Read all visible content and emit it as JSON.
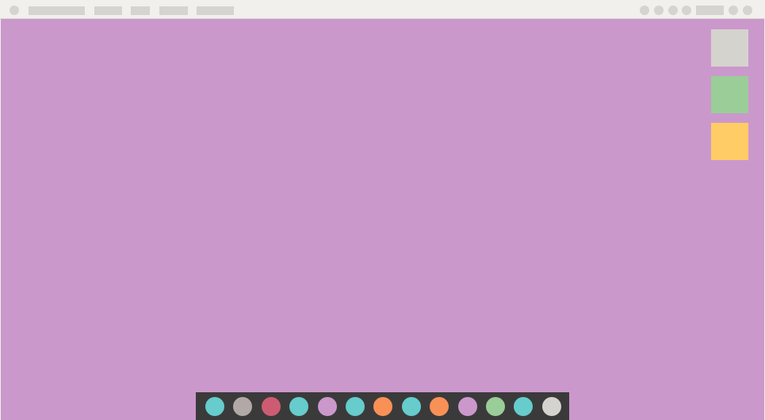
{
  "menubar": {
    "items": [
      {
        "name": "app-menu-icon"
      },
      {
        "name": "app-name-placeholder"
      },
      {
        "name": "menu-item-1"
      },
      {
        "name": "menu-item-2"
      },
      {
        "name": "menu-item-3"
      },
      {
        "name": "menu-item-4"
      }
    ],
    "status_icons": [
      "status-icon-1",
      "status-icon-2",
      "status-icon-3",
      "status-icon-4",
      "clock-placeholder",
      "status-icon-5",
      "status-icon-6"
    ]
  },
  "desktop": {
    "background_color": "#cb98cc",
    "icons": [
      {
        "name": "desktop-icon-1",
        "color": "#d5d3ce"
      },
      {
        "name": "desktop-icon-2",
        "color": "#9acd98"
      },
      {
        "name": "desktop-icon-3",
        "color": "#ffcc66"
      }
    ]
  },
  "dock": {
    "background_color": "#3b3a3b",
    "items": [
      {
        "name": "dock-app-1",
        "color": "#66cccc"
      },
      {
        "name": "dock-app-2",
        "color": "#b2a9a6"
      },
      {
        "name": "dock-app-3",
        "color": "#cd5c73"
      },
      {
        "name": "dock-app-4",
        "color": "#66cccc"
      },
      {
        "name": "dock-app-5",
        "color": "#cb98cc"
      },
      {
        "name": "dock-app-6",
        "color": "#66cccc"
      },
      {
        "name": "dock-app-7",
        "color": "#f99157"
      },
      {
        "name": "dock-app-8",
        "color": "#66cccc"
      },
      {
        "name": "dock-app-9",
        "color": "#f99157"
      },
      {
        "name": "dock-app-10",
        "color": "#cb98cc"
      },
      {
        "name": "dock-app-11",
        "color": "#9acd98"
      },
      {
        "name": "dock-app-12",
        "color": "#66cccc"
      },
      {
        "name": "dock-app-13",
        "color": "#d5d3ce"
      }
    ]
  }
}
